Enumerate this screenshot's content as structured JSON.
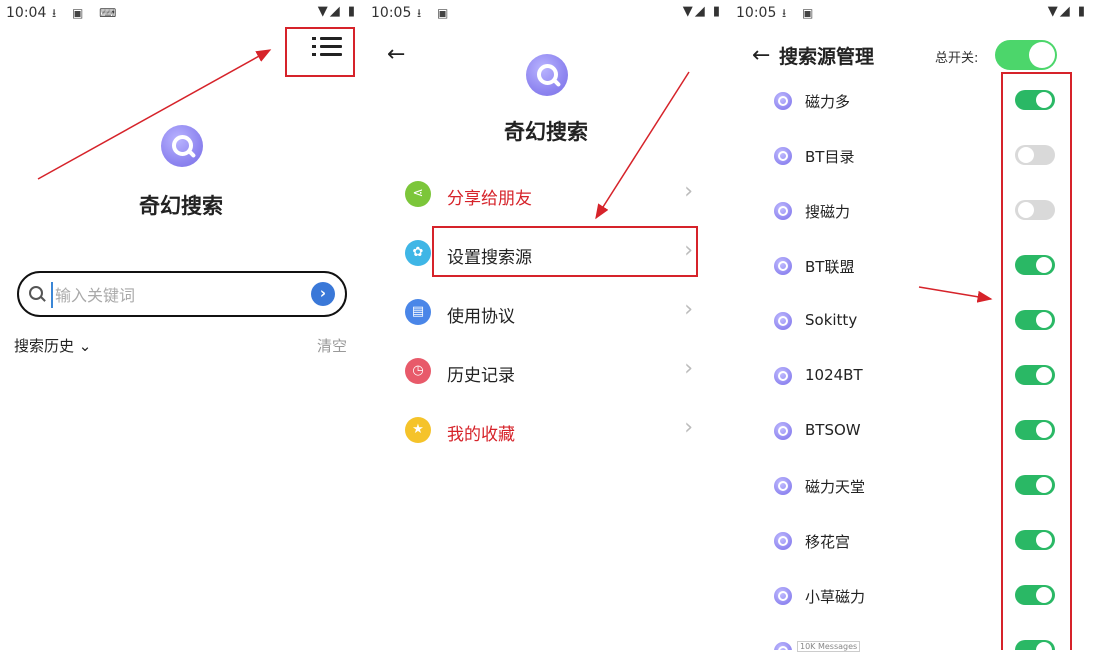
{
  "panel1": {
    "status": {
      "time": "10:04",
      "icons": "⭳ ▣ ⌨",
      "right": "▼◢ ▮"
    },
    "app_title": "奇幻搜索",
    "search": {
      "placeholder": "输入关键词",
      "go_icon": "›"
    },
    "history_label": "搜索历史 ⌄",
    "clear_label": "清空"
  },
  "panel2": {
    "status": {
      "time": "10:05",
      "icons": "⭳ ▣",
      "right": "▼◢ ▮"
    },
    "back_icon": "←",
    "app_title": "奇幻搜索",
    "menu": [
      {
        "label": "分享给朋友",
        "icon": "share-icon",
        "glyph": "⋖",
        "color": "#7cc63a",
        "text_color": "#d6232a"
      },
      {
        "label": "设置搜索源",
        "icon": "gear-icon",
        "glyph": "✿",
        "color": "#3fb6e6",
        "text_color": "#222222"
      },
      {
        "label": "使用协议",
        "icon": "document-icon",
        "glyph": "▤",
        "color": "#4a86e8",
        "text_color": "#222222"
      },
      {
        "label": "历史记录",
        "icon": "clock-icon",
        "glyph": "◷",
        "color": "#e85a6a",
        "text_color": "#222222"
      },
      {
        "label": "我的收藏",
        "icon": "star-icon",
        "glyph": "★",
        "color": "#f5c32a",
        "text_color": "#d6232a"
      }
    ],
    "chevron": "›"
  },
  "panel3": {
    "status": {
      "time": "10:05",
      "icons": "⭳ ▣",
      "right": "▼◢ ▮"
    },
    "back_icon": "←",
    "title": "搜索源管理",
    "master_label": "总开关:",
    "master_on": true,
    "sources": [
      {
        "name": "磁力多",
        "on": true
      },
      {
        "name": "BT目录",
        "on": false
      },
      {
        "name": "搜磁力",
        "on": false
      },
      {
        "name": "BT联盟",
        "on": true
      },
      {
        "name": "Sokitty",
        "on": true
      },
      {
        "name": "1024BT",
        "on": true
      },
      {
        "name": "BTSOW",
        "on": true
      },
      {
        "name": "磁力天堂",
        "on": true
      },
      {
        "name": "移花宫",
        "on": true
      },
      {
        "name": "小草磁力",
        "on": true
      },
      {
        "name": "",
        "on": true
      }
    ],
    "watermark": "10K Messages"
  },
  "colors": {
    "accent_red": "#d6232a",
    "toggle_on": "#2ab865",
    "toggle_off": "#d9d9d9",
    "master_on": "#4cd66b"
  }
}
